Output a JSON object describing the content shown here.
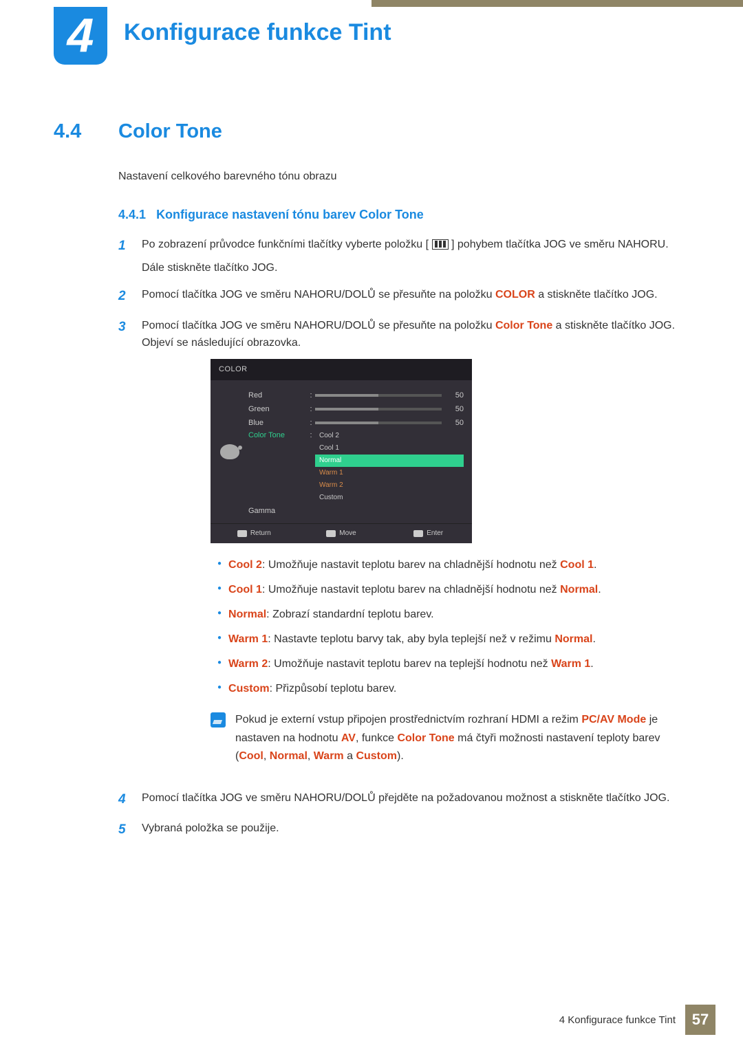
{
  "chapter": {
    "num": "4",
    "title": "Konfigurace funkce Tint"
  },
  "section": {
    "num": "4.4",
    "title": "Color Tone",
    "intro": "Nastavení celkového barevného tónu obrazu"
  },
  "subsection": {
    "num": "4.4.1",
    "title": "Konfigurace nastavení tónu barev Color Tone"
  },
  "steps": {
    "s1a": "Po zobrazení průvodce funkčními tlačítky vyberte položku [",
    "s1b": "] pohybem tlačítka JOG ve směru NAHORU.",
    "s1c": "Dále stiskněte tlačítko JOG.",
    "s2a": "Pomocí tlačítka JOG ve směru NAHORU/DOLŮ se přesuňte na položku ",
    "s2_color": "COLOR",
    "s2b": " a stiskněte tlačítko JOG.",
    "s3a": "Pomocí tlačítka JOG ve směru NAHORU/DOLŮ se přesuňte na položku ",
    "s3_ct": "Color Tone",
    "s3b": " a stiskněte tlačítko JOG. Objeví se následující obrazovka.",
    "s4": "Pomocí tlačítka JOG ve směru NAHORU/DOLŮ přejděte na požadovanou možnost a stiskněte tlačítko JOG.",
    "s5": "Vybraná položka se použije."
  },
  "osd": {
    "title": "COLOR",
    "rows": {
      "red": {
        "label": "Red",
        "value": "50"
      },
      "green": {
        "label": "Green",
        "value": "50"
      },
      "blue": {
        "label": "Blue",
        "value": "50"
      },
      "ct": {
        "label": "Color Tone"
      },
      "gamma": {
        "label": "Gamma"
      }
    },
    "options": [
      "Cool 2",
      "Cool 1",
      "Normal",
      "Warm 1",
      "Warm 2",
      "Custom"
    ],
    "footer": {
      "return": "Return",
      "move": "Move",
      "enter": "Enter"
    }
  },
  "bullets": {
    "b1_name": "Cool 2",
    "b1_text": ": Umožňuje nastavit teplotu barev na chladnější hodnotu než ",
    "b1_ref": "Cool 1",
    "b2_name": "Cool 1",
    "b2_text": ": Umožňuje nastavit teplotu barev na chladnější hodnotu než ",
    "b2_ref": "Normal",
    "b3_name": "Normal",
    "b3_text": ": Zobrazí standardní teplotu barev.",
    "b4_name": "Warm 1",
    "b4_text": ": Nastavte teplotu barvy tak, aby byla teplejší než v režimu ",
    "b4_ref": "Normal",
    "b5_name": "Warm 2",
    "b5_text": ": Umožňuje nastavit teplotu barev na teplejší hodnotu než ",
    "b5_ref": "Warm 1",
    "b6_name": "Custom",
    "b6_text": ": Přizpůsobí teplotu barev."
  },
  "note": {
    "t1": "Pokud je externí vstup připojen prostřednictvím rozhraní HDMI a režim ",
    "pcav": "PC/AV Mode",
    "t2": " je nastaven na hodnotu ",
    "av": "AV",
    "t3": ", funkce ",
    "ct": "Color Tone",
    "t4": " má čtyři možnosti nastavení teploty barev (",
    "cool": "Cool",
    "c1": ", ",
    "normal": "Normal",
    "c2": ", ",
    "warm": "Warm",
    "t5": " a ",
    "custom": "Custom",
    "t6": ")."
  },
  "footer": {
    "text": "4 Konfigurace funkce Tint",
    "page": "57"
  }
}
